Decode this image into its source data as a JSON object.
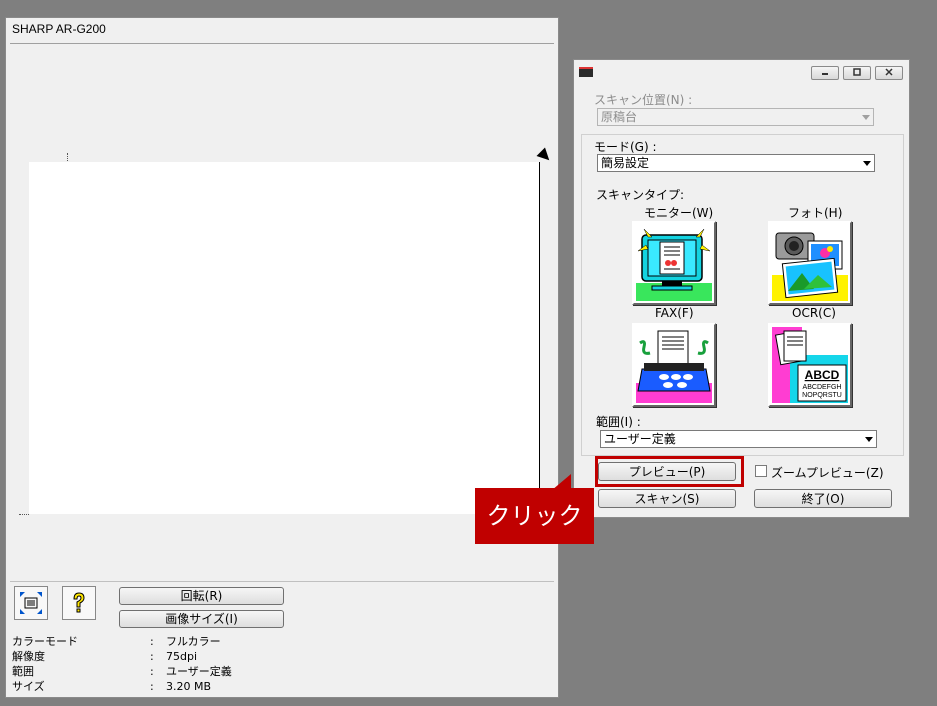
{
  "left_window": {
    "title": "SHARP AR-G200",
    "buttons": {
      "rotate": "回転(R)",
      "image_size": "画像サイズ(I)"
    },
    "icons": {
      "fit": "fit-page-icon",
      "help": "help-icon"
    },
    "info": [
      {
        "label": "カラーモード",
        "sep": ":",
        "value": "フルカラー"
      },
      {
        "label": "解像度",
        "sep": ":",
        "value": "75dpi"
      },
      {
        "label": "範囲",
        "sep": ":",
        "value": "ユーザー定義"
      },
      {
        "label": "サイズ",
        "sep": ":",
        "value": "3.20 MB"
      }
    ]
  },
  "dialog": {
    "scan_position_label": "スキャン位置(N) :",
    "scan_position_value": "原稿台",
    "mode_label": "モード(G) :",
    "mode_value": "簡易設定",
    "scan_type_label": "スキャンタイプ:",
    "scan_types": [
      {
        "label": "モニター(W)",
        "icon": "monitor-icon"
      },
      {
        "label": "フォト(H)",
        "icon": "photo-icon"
      },
      {
        "label": "FAX(F)",
        "icon": "fax-icon"
      },
      {
        "label": "OCR(C)",
        "icon": "ocr-icon"
      }
    ],
    "ocr_sample_big": "ABCD",
    "ocr_sample_small1": "ABCDEFGH",
    "ocr_sample_small2": "NOPQRSTU",
    "range_label": "範囲(I) :",
    "range_value": "ユーザー定義",
    "preview_button": "プレビュー(P)",
    "zoom_preview_label": "ズームプレビュー(Z)",
    "scan_button": "スキャン(S)",
    "exit_button": "終了(O)"
  },
  "callout": {
    "text": "クリック",
    "color": "#c00000"
  }
}
